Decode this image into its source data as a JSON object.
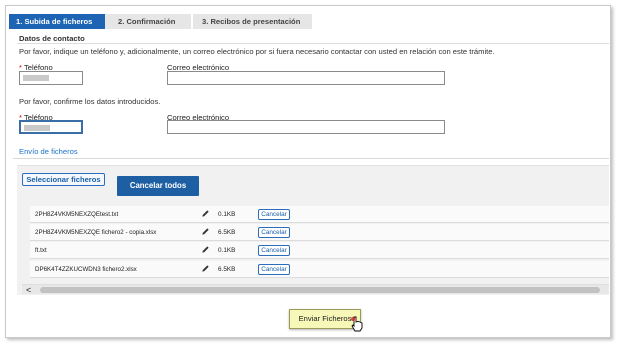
{
  "tabs": [
    {
      "label": "1. Subida de ficheros"
    },
    {
      "label": "2. Confirmación"
    },
    {
      "label": "3. Recibos de presentación"
    }
  ],
  "contact": {
    "section_title": "Datos de contacto",
    "instruction": "Por favor, indique un teléfono y, adicionalmente, un correo electrónico por si fuera necesario contactar con usted en relación con este trámite.",
    "confirm_instruction": "Por favor, confirme los datos introducidos.",
    "required_mark": "*",
    "phone_label": "Teléfono",
    "email_label": "Correo electrónico"
  },
  "upload": {
    "section_link": "Envío de ficheros",
    "select_button": "Seleccionar ficheros",
    "cancel_all_button": "Cancelar todos",
    "files": [
      {
        "name": "2PH8Z4VKM5NEXZQEtest.txt",
        "size": "0.1KB",
        "cancel": "Cancelar"
      },
      {
        "name": "2PH8Z4VKM5NEXZQE fichero2 - copia.xlsx",
        "size": "6.5KB",
        "cancel": "Cancelar"
      },
      {
        "name": "ft.txt",
        "size": "0.1KB",
        "cancel": "Cancelar"
      },
      {
        "name": "DP6K4T4ZZKUCWDN3 fichero2.xlsx",
        "size": "6.5KB",
        "cancel": "Cancelar"
      }
    ],
    "scroll_left": "<"
  },
  "send_button": "Enviar Ficheros",
  "colors": {
    "accent": "#1d64b4",
    "send_bg": "#f7f7b8",
    "required": "#cc0000",
    "link": "#1a73c8"
  }
}
